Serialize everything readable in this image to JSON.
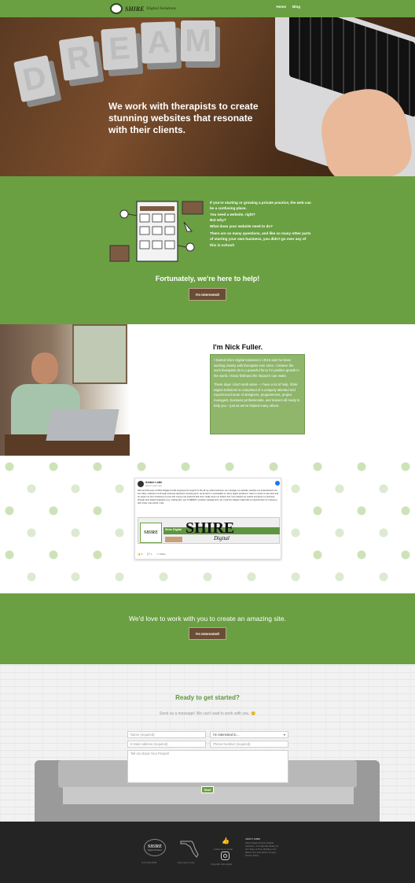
{
  "header": {
    "logo_text": "SHIRE",
    "logo_sub": "Digital Solutions",
    "nav": [
      "Home",
      "Blog"
    ]
  },
  "hero": {
    "letters": [
      "D",
      "R",
      "E",
      "A",
      "M"
    ],
    "headline": "We work with therapists to create stunning websites that resonate with their clients."
  },
  "intro": {
    "lines": [
      "If you're starting or growing a private practice, the web can be a confusing place.",
      "You need a website, right?",
      "But why?",
      "What does your website need to do?",
      "There are so many questions, and like so many other parts of starting your own business, you didn't go over any of this in school!"
    ],
    "fortunately": "Fortunately, we're here to help!",
    "button": "I'm Interested!"
  },
  "about": {
    "name": "I'm Nick Fuller.",
    "paragraphs": [
      "I started Shire Digital Solutions in 2016 and I've been working closely with therapists ever since. I believe the work therapists do is a powerful force for positive growth in the world. I know firsthand the impact it can make.",
      "These days I don't work alone – I have a lot of help. Shire Digital Solutions is comprised of a uniquely talented and experienced team of designers, programmers, project managers, business professionals, and trainers all ready to help you – just as we've helped many others."
    ]
  },
  "testimonial": {
    "author": "Amber Lotts",
    "date": "about 2 years ago",
    "body": "Nick and the team at Shire Digital provide ongoing tech support to the all my online business. He manages my website, teaches me essential tech via live video, coaches me through business decisions involving tech. He knows I'm susceptible to \"shiny object syndrome\" when it comes to new tech and he saves me from investing my time and money into products that won't really serve me bottom line. He's helped me market and grow my business through tech-based strategies (e.g. mailing lists, use of REDDIT, youtube management, etc.) and he's always really fast to respond when I'm having a tech crisis. (can which i cite).",
    "page_name": "Shire Digital",
    "banner_word": "SHIRE",
    "banner_sub": "Digital",
    "reactions": [
      "👍 5",
      "💬 1",
      "↪ Share"
    ]
  },
  "cta2": {
    "text": "We'd love to work with you to create an amazing site.",
    "button": "I'm Interested!"
  },
  "contact": {
    "title": "Ready to get started?",
    "subtitle": "Send us a message! We can't wait to work with you. 😊",
    "name_placeholder": "Name (required)",
    "interest_value": "I'm interested in...",
    "email_placeholder": "E-Mail Address (required)",
    "phone_placeholder": "Phone Number (required)",
    "message_placeholder": "Tell Us About Your Project!",
    "send": "Send"
  },
  "footer": {
    "logo_text": "SHIRE",
    "logo_sub": "Digital Solutions",
    "logo_caption": "(727) 543-2345",
    "map_caption": "Now open in new",
    "social_caption": "Follow us on social",
    "insta_caption": "Copyright shire digital",
    "about_title": "ABOUT SHIRE",
    "about_text": "Shire Digital Solutions Digital Solutions. You Might Be Ready for Our Team of Pros. Building Your Brand: The Importance of Logo. Privacy Policy"
  },
  "colors": {
    "brand_green": "#6aa042",
    "button_brown": "#6b4c35",
    "footer_bg": "#242424"
  }
}
